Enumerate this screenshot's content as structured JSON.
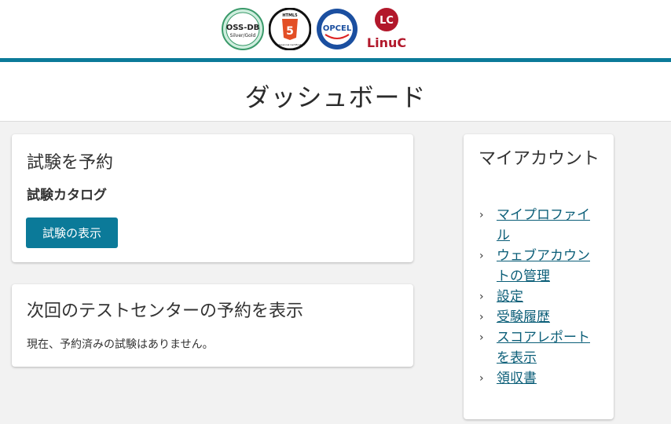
{
  "header": {
    "logos": {
      "ossdb": {
        "line1": "OSS-DB",
        "line2": "Silver/Gold"
      },
      "html5": {
        "top": "HTML5",
        "number": "5",
        "bottom": "Professional Certification"
      },
      "opcel": {
        "text": "OPCEL"
      },
      "linuc": {
        "badge": "LC",
        "text": "LinuC"
      }
    },
    "accent_color": "#0b7a99"
  },
  "page": {
    "title": "ダッシュボード"
  },
  "reserve_card": {
    "title": "試験を予約",
    "catalog_label": "試験カタログ",
    "view_button": "試験の表示"
  },
  "next_card": {
    "title": "次回のテストセンターの予約を表示",
    "message": "現在、予約済みの試験はありません。"
  },
  "account_card": {
    "title": "マイアカウント",
    "links": [
      {
        "label": "マイプロファイル"
      },
      {
        "label": "ウェブアカウントの管理"
      },
      {
        "label": "設定"
      },
      {
        "label": "受験履歴"
      },
      {
        "label": "スコアレポートを表示"
      },
      {
        "label": "領収書"
      }
    ]
  }
}
